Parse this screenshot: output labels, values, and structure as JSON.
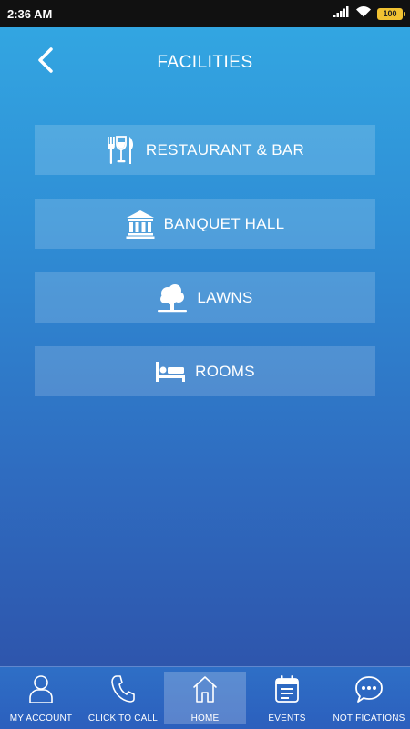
{
  "status_bar": {
    "time": "2:36 AM",
    "battery": "100"
  },
  "header": {
    "title": "FACILITIES",
    "back_icon": "chevron-left-icon"
  },
  "menu": {
    "items": [
      {
        "label": "RESTAURANT & BAR",
        "icon": "restaurant-icon"
      },
      {
        "label": "BANQUET HALL",
        "icon": "banquet-hall-icon"
      },
      {
        "label": "LAWNS",
        "icon": "tree-icon"
      },
      {
        "label": "ROOMS",
        "icon": "bed-icon"
      }
    ]
  },
  "tabbar": {
    "tabs": [
      {
        "label": "MY ACCOUNT",
        "icon": "user-icon"
      },
      {
        "label": "CLICK TO CALL",
        "icon": "phone-icon"
      },
      {
        "label": "HOME",
        "icon": "home-icon",
        "active": true
      },
      {
        "label": "EVENTS",
        "icon": "calendar-icon"
      },
      {
        "label": "NOTIFICATIONS",
        "icon": "chat-bubble-icon"
      }
    ]
  },
  "colors": {
    "gradient_top": "#33a9e3",
    "gradient_bottom": "#2d4ea6",
    "battery": "#f1c232"
  }
}
